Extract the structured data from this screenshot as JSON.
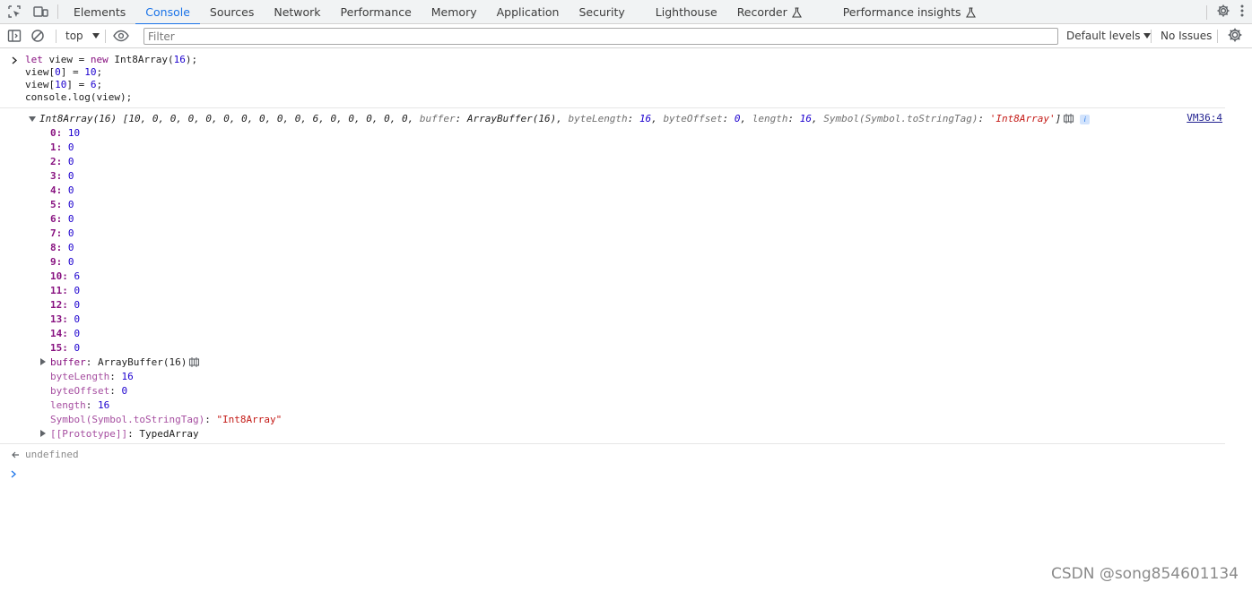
{
  "tabs": [
    {
      "label": "Elements"
    },
    {
      "label": "Console"
    },
    {
      "label": "Sources"
    },
    {
      "label": "Network"
    },
    {
      "label": "Performance"
    },
    {
      "label": "Memory"
    },
    {
      "label": "Application"
    },
    {
      "label": "Security"
    },
    {
      "label": "Lighthouse"
    },
    {
      "label": "Recorder"
    },
    {
      "label": "Performance insights"
    }
  ],
  "active_tab": "Console",
  "toolbar": {
    "context": "top",
    "filter_placeholder": "Filter",
    "levels": "Default levels",
    "issues": "No Issues"
  },
  "input": {
    "lines": [
      [
        {
          "t": "let",
          "c": "kw"
        },
        {
          "t": " view = ",
          "c": "plain"
        },
        {
          "t": "new",
          "c": "kw"
        },
        {
          "t": " Int8Array(",
          "c": "plain"
        },
        {
          "t": "16",
          "c": "num"
        },
        {
          "t": ");",
          "c": "plain"
        }
      ],
      [
        {
          "t": "view[",
          "c": "plain"
        },
        {
          "t": "0",
          "c": "num"
        },
        {
          "t": "] = ",
          "c": "plain"
        },
        {
          "t": "10",
          "c": "num"
        },
        {
          "t": ";",
          "c": "plain"
        }
      ],
      [
        {
          "t": "view[",
          "c": "plain"
        },
        {
          "t": "10",
          "c": "num"
        },
        {
          "t": "] = ",
          "c": "plain"
        },
        {
          "t": "6",
          "c": "num"
        },
        {
          "t": ";",
          "c": "plain"
        }
      ],
      [
        {
          "t": "console.log(view);",
          "c": "plain"
        }
      ]
    ]
  },
  "output": {
    "summary": {
      "type_name": "Int8Array(16)",
      "values_preview": "10, 0, 0, 0, 0, 0, 0, 0, 0, 0, 6, 0, 0, 0, 0, 0",
      "buffer_label": "buffer",
      "buffer_value": "ArrayBuffer(16)",
      "byteLength_label": "byteLength",
      "byteLength_value": "16",
      "byteOffset_label": "byteOffset",
      "byteOffset_value": "0",
      "length_label": "length",
      "length_value": "16",
      "tag_label": "Symbol(Symbol.toStringTag)",
      "tag_value": "'Int8Array'"
    },
    "source_link": "VM36:4",
    "elements": [
      {
        "index": "0",
        "value": "10"
      },
      {
        "index": "1",
        "value": "0"
      },
      {
        "index": "2",
        "value": "0"
      },
      {
        "index": "3",
        "value": "0"
      },
      {
        "index": "4",
        "value": "0"
      },
      {
        "index": "5",
        "value": "0"
      },
      {
        "index": "6",
        "value": "0"
      },
      {
        "index": "7",
        "value": "0"
      },
      {
        "index": "8",
        "value": "0"
      },
      {
        "index": "9",
        "value": "0"
      },
      {
        "index": "10",
        "value": "6"
      },
      {
        "index": "11",
        "value": "0"
      },
      {
        "index": "12",
        "value": "0"
      },
      {
        "index": "13",
        "value": "0"
      },
      {
        "index": "14",
        "value": "0"
      },
      {
        "index": "15",
        "value": "0"
      }
    ],
    "props": {
      "buffer_label": "buffer",
      "buffer_value": "ArrayBuffer(16)",
      "byteLength_label": "byteLength",
      "byteLength_value": "16",
      "byteOffset_label": "byteOffset",
      "byteOffset_value": "0",
      "length_label": "length",
      "length_value": "16",
      "tag_label": "Symbol(Symbol.toStringTag)",
      "tag_value": "\"Int8Array\"",
      "prototype_label": "[[Prototype]]",
      "prototype_value": "TypedArray"
    }
  },
  "result": "undefined",
  "watermark": "CSDN @song854601134"
}
